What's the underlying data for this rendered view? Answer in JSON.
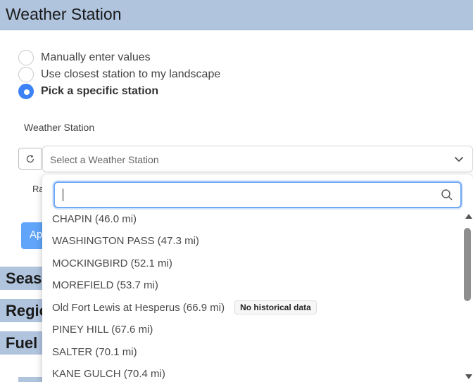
{
  "header": {
    "title": "Weather Station"
  },
  "source_options": [
    {
      "label": "Manually enter values",
      "checked": false
    },
    {
      "label": "Use closest station to my landscape",
      "checked": false
    },
    {
      "label": "Pick a specific station",
      "checked": true
    }
  ],
  "station_field": {
    "label": "Weather Station",
    "placeholder": "Select a Weather Station",
    "refresh_icon": "refresh-icon",
    "chevron_icon": "chevron-down-icon"
  },
  "behind": {
    "partial_label": "Ra",
    "partial_button": "Ap"
  },
  "sections": [
    "Seaso",
    "Regio",
    "Fuel"
  ],
  "dropdown": {
    "search_value": "",
    "search_icon": "search-icon",
    "items": [
      {
        "label": "CHAPIN (46.0 mi)",
        "tag": ""
      },
      {
        "label": "WASHINGTON PASS (47.3 mi)",
        "tag": ""
      },
      {
        "label": "MOCKINGBIRD (52.1 mi)",
        "tag": ""
      },
      {
        "label": "MOREFIELD (53.7 mi)",
        "tag": ""
      },
      {
        "label": "Old Fort Lewis at Hesperus (66.9 mi)",
        "tag": "No historical data"
      },
      {
        "label": "PINEY HILL (67.6 mi)",
        "tag": ""
      },
      {
        "label": "SALTER (70.1 mi)",
        "tag": ""
      },
      {
        "label": "KANE GULCH (70.4 mi)",
        "tag": ""
      }
    ]
  },
  "colors": {
    "header_bg": "#b0c4de",
    "accent": "#3b82f6",
    "focus_ring": "#6fa8f3"
  }
}
